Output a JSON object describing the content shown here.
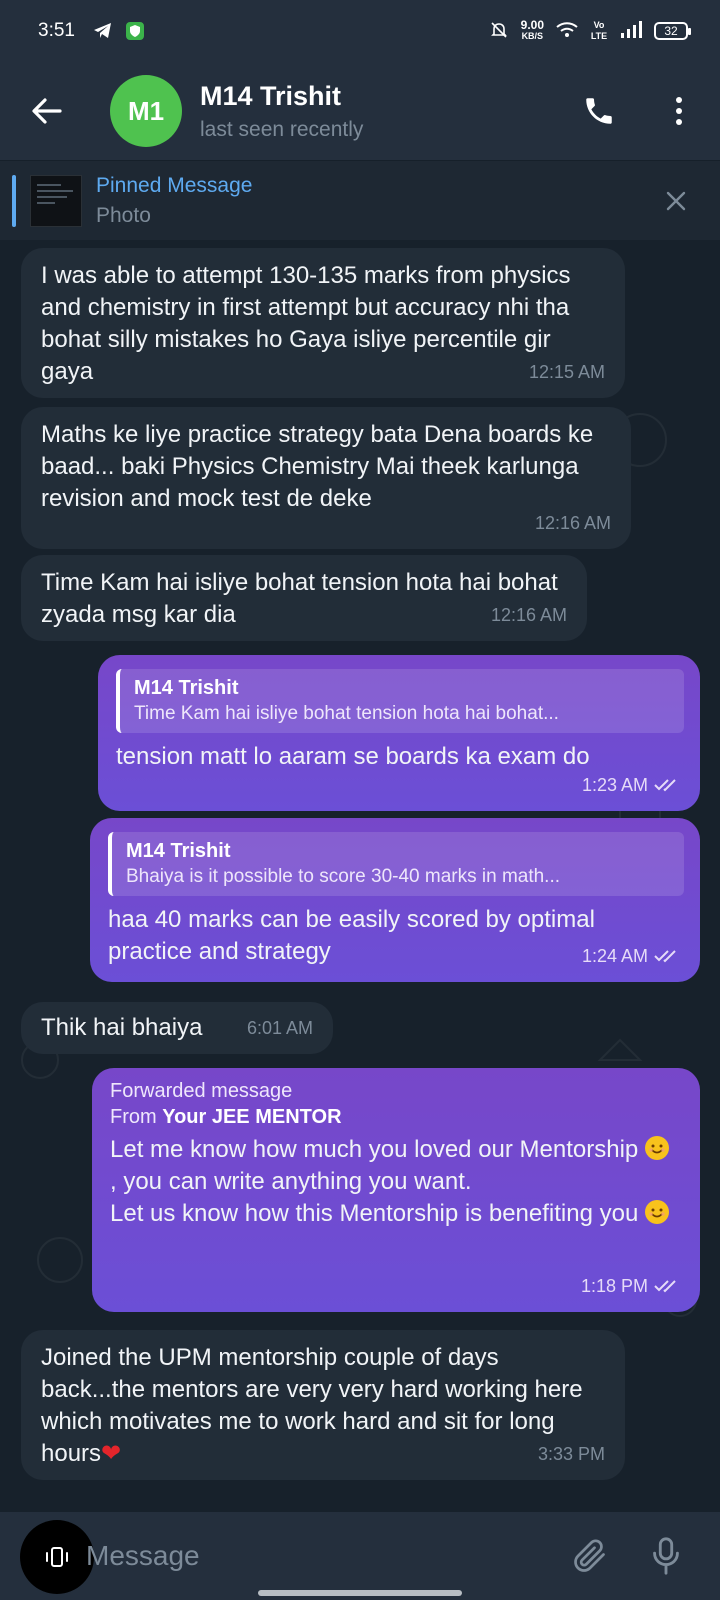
{
  "status_bar": {
    "time": "3:51",
    "net_speed_value": "9.00",
    "net_speed_unit": "KB/S",
    "volte": "Vo LTE",
    "battery": "32"
  },
  "header": {
    "avatar_initials": "M1",
    "contact_name": "M14 Trishit",
    "status": "last seen recently"
  },
  "pinned": {
    "title": "Pinned Message",
    "subtitle": "Photo"
  },
  "messages": [
    {
      "text": "I was able to attempt 130-135 marks from physics and chemistry in first attempt but accuracy nhi tha bohat silly mistakes ho Gaya isliye percentile gir gaya",
      "time": "12:15 AM"
    },
    {
      "text": "Maths ke liye practice strategy bata Dena boards ke baad... baki Physics Chemistry Mai theek karlunga revision and mock test de deke",
      "time": "12:16 AM"
    },
    {
      "text": "Time Kam hai isliye bohat tension hota hai bohat zyada msg kar dia",
      "time": "12:16 AM"
    },
    {
      "reply_name": "M14 Trishit",
      "reply_text": "Time Kam hai isliye bohat tension hota hai bohat...",
      "text": "tension matt lo aaram se boards ka exam do",
      "time": "1:23 AM"
    },
    {
      "reply_name": "M14 Trishit",
      "reply_text": "Bhaiya is it possible to score 30-40 marks in math...",
      "text": "haa 40 marks can be easily scored by optimal practice and strategy",
      "time": "1:24 AM"
    },
    {
      "text": "Thik hai bhaiya",
      "time": "6:01 AM"
    },
    {
      "fwd_label": "Forwarded message",
      "fwd_from_prefix": "From ",
      "fwd_from_name": "Your JEE MENTOR",
      "line1": "Let me know how much you loved our Mentorship",
      "line2": ", you can write anything you want.",
      "line3": "Let us know how this Mentorship is benefiting you",
      "time": "1:18 PM"
    },
    {
      "text": "Joined the UPM mentorship couple of days back...the mentors are very very hard working here which motivates me to work hard and sit for long hours",
      "time": "3:33 PM"
    }
  ],
  "composer": {
    "placeholder": "Message"
  },
  "colors": {
    "accent": "#5eaaf0",
    "avatar": "#4fc24f",
    "outgoing_bubble": "#7747c9",
    "incoming_bubble": "#222d38"
  }
}
